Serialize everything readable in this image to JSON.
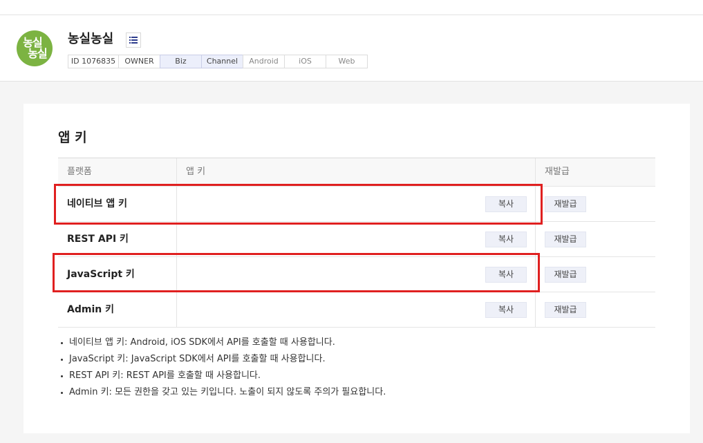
{
  "app": {
    "name": "농실농실",
    "logo_text": [
      "농실",
      "농실"
    ],
    "badges": [
      {
        "label": "ID 1076835",
        "state": "normal"
      },
      {
        "label": "OWNER",
        "state": "normal"
      },
      {
        "label": "Biz",
        "state": "active"
      },
      {
        "label": "Channel",
        "state": "active"
      },
      {
        "label": "Android",
        "state": "dim"
      },
      {
        "label": "iOS",
        "state": "dim"
      },
      {
        "label": "Web",
        "state": "dim"
      }
    ]
  },
  "section": {
    "title": "앱 키"
  },
  "table": {
    "headers": [
      "플랫폼",
      "앱 키",
      "재발급"
    ],
    "rows": [
      {
        "name": "네이티브 앱 키",
        "key": "",
        "copy_label": "복사",
        "reissue_label": "재발급",
        "highlighted": true
      },
      {
        "name": "REST API 키",
        "key": "",
        "copy_label": "복사",
        "reissue_label": "재발급",
        "highlighted": false
      },
      {
        "name": "JavaScript 키",
        "key": "",
        "copy_label": "복사",
        "reissue_label": "재발급",
        "highlighted": true
      },
      {
        "name": "Admin 키",
        "key": "",
        "copy_label": "복사",
        "reissue_label": "재발급",
        "highlighted": false
      }
    ]
  },
  "notes": [
    "네이티브 앱 키: Android, iOS SDK에서 API를 호출할 때 사용합니다.",
    "JavaScript 키: JavaScript SDK에서 API를 호출할 때 사용합니다.",
    "REST API 키: REST API를 호출할 때 사용합니다.",
    "Admin 키: 모든 권한을 갖고 있는 키입니다. 노출이 되지 않도록 주의가 필요합니다."
  ],
  "colors": {
    "highlight": "#e02020",
    "logo": "#7cb342",
    "active_badge": "#eceffb"
  },
  "icons": {
    "menu": "list-icon"
  }
}
